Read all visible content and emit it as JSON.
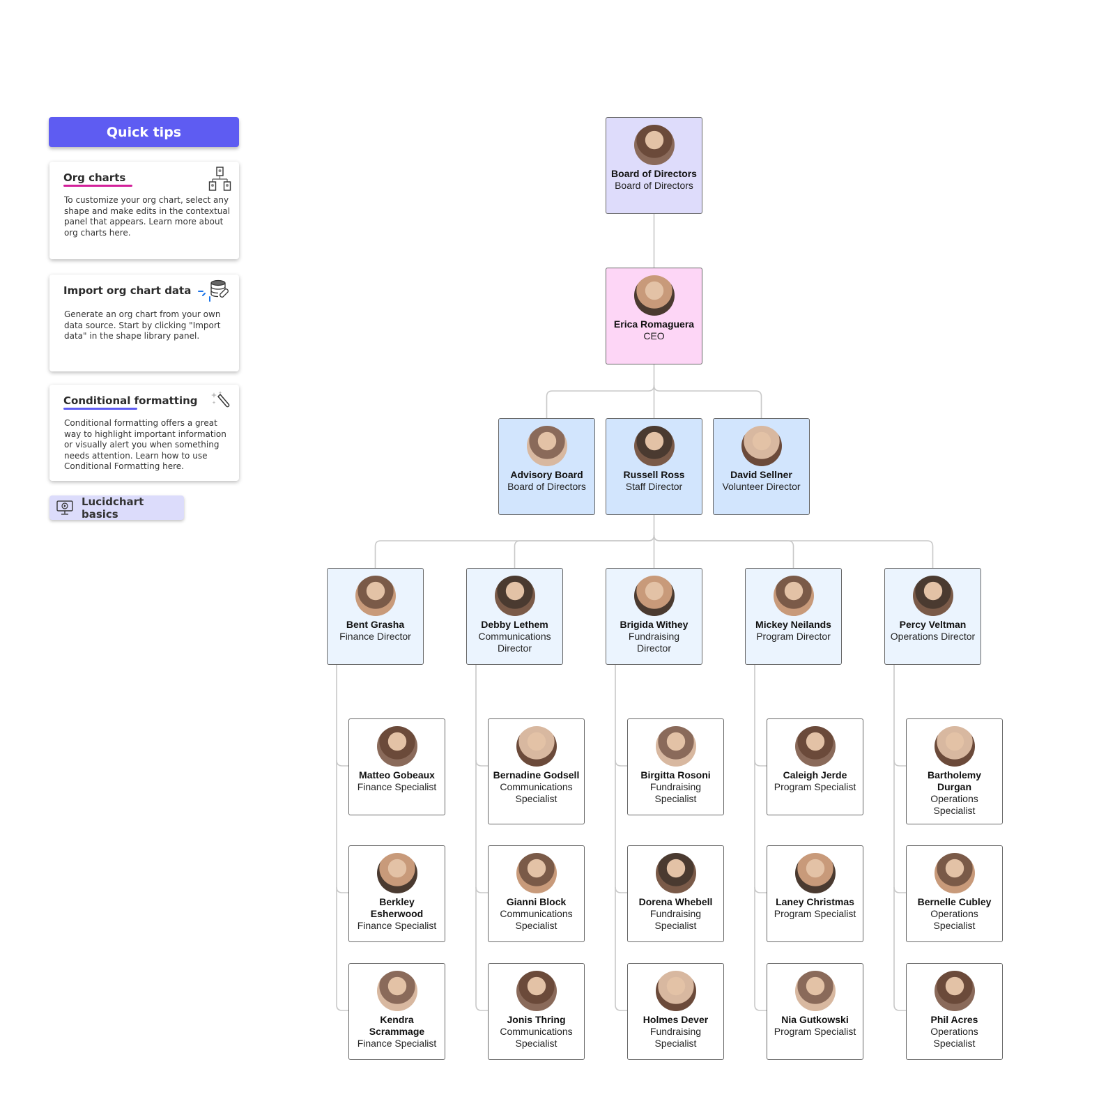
{
  "quick_tips": {
    "header": "Quick tips",
    "tips": [
      {
        "title_underlined": "Org charts",
        "title_rest": "",
        "body": "To customize your org chart, select any shape and make edits in the contextual panel that appears. Learn more about org charts here.",
        "icon": "org-chart-icon",
        "underline_color": "#d21f9a"
      },
      {
        "title_underlined": "",
        "title_rest": "Import org chart data",
        "body": "Generate an org chart from your own data source. Start by clicking \"Import data\" in the shape library panel.",
        "icon": "database-link-icon"
      },
      {
        "title_underlined": "Conditional",
        "title_rest": " formatting",
        "body": "Conditional formatting offers a great way to highlight important information or visually alert you when something needs attention. Learn how to use Conditional Formatting here.",
        "icon": "magic-wand-icon",
        "underline_color": "#5e5cf2"
      }
    ],
    "basics_button": "Lucidchart basics"
  },
  "colors": {
    "board": "#dedcfb",
    "ceo": "#fdd6f6",
    "level2": "#d2e5fd",
    "directors": "#ebf4fe",
    "specialists": "#ffffff",
    "connector": "#c8c8c8"
  },
  "org": {
    "board": {
      "name": "Board of Directors",
      "role": "Board of Directors"
    },
    "ceo": {
      "name": "Erica Romaguera",
      "role": "CEO"
    },
    "level2": [
      {
        "name": "Advisory Board",
        "role": "Board of Directors"
      },
      {
        "name": "Russell Ross",
        "role": "Staff Director"
      },
      {
        "name": "David Sellner",
        "role": "Volunteer Director"
      }
    ],
    "directors": [
      {
        "name": "Bent Grasha",
        "role": "Finance Director",
        "team": [
          {
            "name": "Matteo Gobeaux",
            "role": "Finance Specialist"
          },
          {
            "name": "Berkley Esherwood",
            "role": "Finance Specialist"
          },
          {
            "name": "Kendra Scrammage",
            "role": "Finance Specialist"
          }
        ]
      },
      {
        "name": "Debby Lethem",
        "role": "Communications Director",
        "team": [
          {
            "name": "Bernadine Godsell",
            "role": "Communications Specialist"
          },
          {
            "name": "Gianni Block",
            "role": "Communications Specialist"
          },
          {
            "name": "Jonis Thring",
            "role": "Communications Specialist"
          }
        ]
      },
      {
        "name": "Brigida Withey",
        "role": "Fundraising Director",
        "team": [
          {
            "name": "Birgitta Rosoni",
            "role": "Fundraising Specialist"
          },
          {
            "name": "Dorena Whebell",
            "role": "Fundraising Specialist"
          },
          {
            "name": "Holmes Dever",
            "role": "Fundraising Specialist"
          }
        ]
      },
      {
        "name": "Mickey Neilands",
        "role": "Program Director",
        "team": [
          {
            "name": "Caleigh Jerde",
            "role": "Program Specialist"
          },
          {
            "name": "Laney Christmas",
            "role": "Program Specialist"
          },
          {
            "name": "Nia Gutkowski",
            "role": "Program Specialist"
          }
        ]
      },
      {
        "name": "Percy Veltman",
        "role": "Operations Director",
        "team": [
          {
            "name": "Bartholemy Durgan",
            "role": "Operations Specialist"
          },
          {
            "name": "Bernelle Cubley",
            "role": "Operations Specialist"
          },
          {
            "name": "Phil Acres",
            "role": "Operations Specialist"
          }
        ]
      }
    ]
  }
}
